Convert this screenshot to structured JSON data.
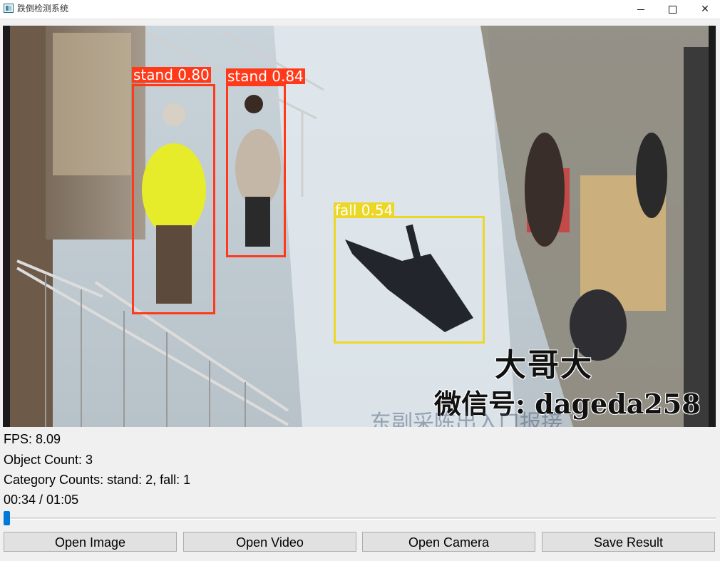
{
  "window": {
    "title": "跌倒检测系统",
    "controls": {
      "minimize": "minimize-icon",
      "maximize": "maximize-icon",
      "close": "✕"
    }
  },
  "video": {
    "detections": [
      {
        "label": "stand 0.80",
        "class": "stand",
        "confidence": 0.8,
        "color": "#ff3a1a"
      },
      {
        "label": "stand 0.84",
        "class": "stand",
        "confidence": 0.84,
        "color": "#ff3a1a"
      },
      {
        "label": "fall 0.54",
        "class": "fall",
        "confidence": 0.54,
        "color": "#ecd727"
      }
    ],
    "watermark": {
      "line1": "大哥大",
      "line2": "微信号: dageda258",
      "line3": "东副采陈出入口报接"
    }
  },
  "info": {
    "fps": "FPS: 8.09",
    "object_count": "Object Count: 3",
    "category_counts": "Category Counts: stand: 2, fall: 1",
    "time": "00:34 / 01:05"
  },
  "progress": {
    "fraction": 0.0,
    "accent": "#0078d7"
  },
  "buttons": {
    "open_image": "Open Image",
    "open_video": "Open Video",
    "open_camera": "Open Camera",
    "save_result": "Save Result"
  }
}
